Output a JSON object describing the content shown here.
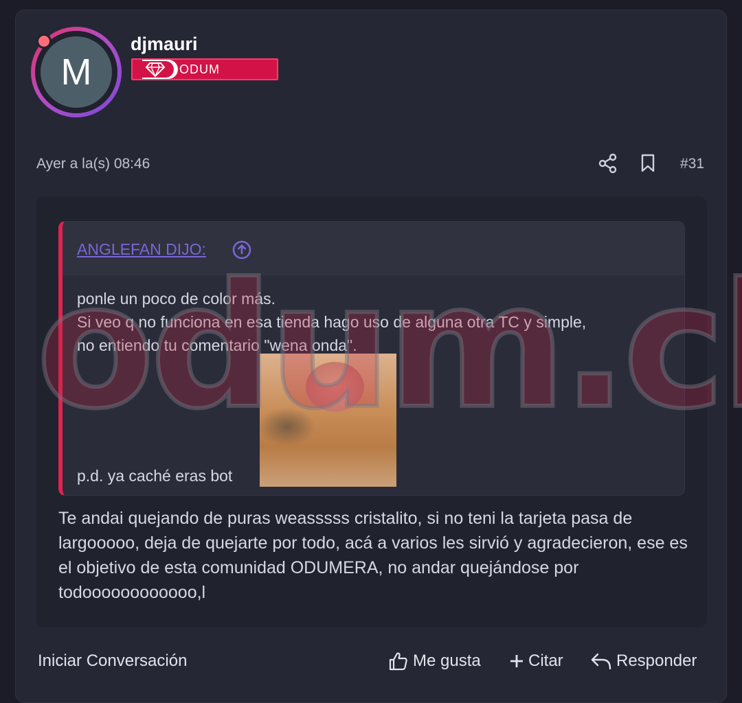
{
  "post": {
    "avatar_letter": "M",
    "username": "djmauri",
    "badge_label": "ODUM",
    "timestamp": "Ayer a la(s) 08:46",
    "post_number": "#31"
  },
  "quote": {
    "author": "ANGLEFAN DIJO:",
    "lines": [
      "ponle un poco de color más.",
      "Si veo q no funciona en esa tienda hago uso de alguna otra TC y simple,",
      "no entiendo tu comentario \"wena onda\"."
    ],
    "ps": "p.d. ya caché eras bot"
  },
  "reply": {
    "text": "Te andai quejando de puras weasssss cristalito, si no teni la tarjeta pasa de largooooo, deja de quejarte por todo, acá a varios les sirvió y agradecieron, ese es el objetivo de esta comunidad ODUMERA, no andar quejándose por todoooooooooooo,l"
  },
  "watermark": "odum.cl",
  "footer": {
    "start_conversation": "Iniciar Conversación",
    "like": "Me gusta",
    "quote": "Citar",
    "reply": "Responder"
  },
  "icons": [
    "share-icon",
    "bookmark-icon",
    "circle-arrow-up-icon",
    "thumbs-up-icon",
    "plus-icon",
    "reply-arrow-icon",
    "gem-icon"
  ],
  "colors": {
    "accent": "#e0244f",
    "link": "#7a66d8",
    "badge": "#d31347"
  }
}
